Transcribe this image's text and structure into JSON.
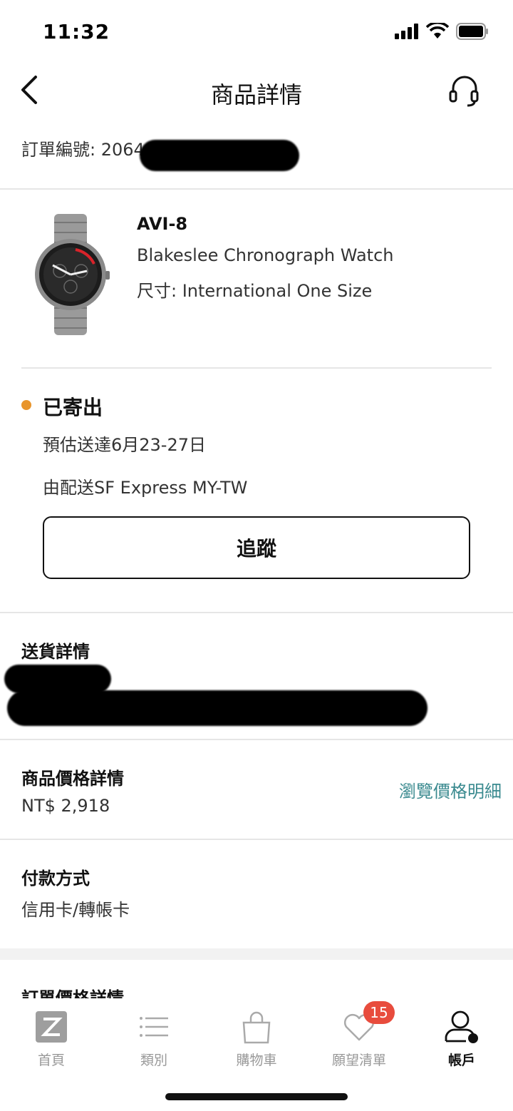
{
  "status_bar": {
    "time": "11:32"
  },
  "nav": {
    "title": "商品詳情"
  },
  "order": {
    "number_label": "訂單編號: 2064"
  },
  "product": {
    "brand": "AVI-8",
    "name": "Blakeslee Chronograph Watch",
    "size": "尺寸: International One Size"
  },
  "shipment": {
    "status": "已寄出",
    "eta": "預估送達6月23-27日",
    "carrier": "由配送SF Express MY-TW",
    "track_label": "追蹤",
    "status_color": "#e8952c"
  },
  "delivery": {
    "title": "送貨詳情"
  },
  "price": {
    "title": "商品價格詳情",
    "value": "NT$ 2,918",
    "link": "瀏覽價格明細",
    "link_color": "#3a8a8f"
  },
  "payment": {
    "title": "付款方式",
    "value": "信用卡/轉帳卡"
  },
  "order_price": {
    "title": "訂單價格詳情"
  },
  "tabs": [
    {
      "label": "首頁",
      "icon": "zalora-logo-icon"
    },
    {
      "label": "類別",
      "icon": "list-icon"
    },
    {
      "label": "購物車",
      "icon": "shopping-bag-icon"
    },
    {
      "label": "願望清單",
      "icon": "heart-icon",
      "badge": "15"
    },
    {
      "label": "帳戶",
      "icon": "account-icon"
    }
  ]
}
